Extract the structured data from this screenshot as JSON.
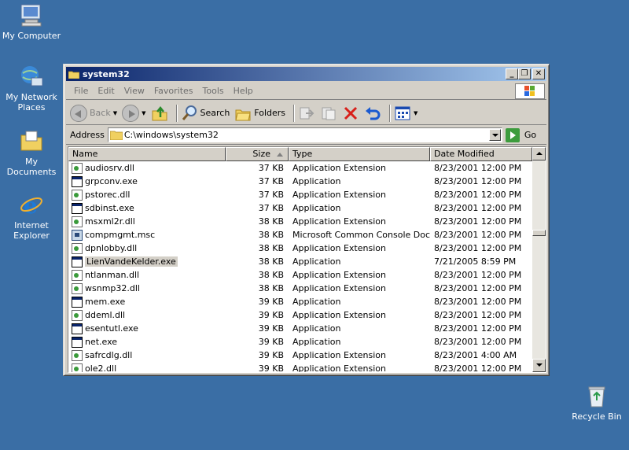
{
  "desktop": {
    "icons": [
      {
        "label": "My Computer"
      },
      {
        "label": "My Network Places"
      },
      {
        "label": "My Documents"
      },
      {
        "label": "Internet Explorer"
      },
      {
        "label": "Recycle Bin"
      }
    ]
  },
  "window": {
    "title": "system32",
    "controls": {
      "minimize": "_",
      "restore": "❐",
      "close": "✕"
    }
  },
  "menu": [
    "File",
    "Edit",
    "View",
    "Favorites",
    "Tools",
    "Help"
  ],
  "toolbar": {
    "back": "Back",
    "search": "Search",
    "folders": "Folders"
  },
  "address": {
    "label": "Address",
    "value": "C:\\windows\\system32",
    "go": "Go"
  },
  "columns": {
    "name": "Name",
    "size": "Size",
    "type": "Type",
    "date": "Date Modified"
  },
  "files": [
    {
      "name": "audiosrv.dll",
      "size": "37 KB",
      "type": "Application Extension",
      "date": "8/23/2001 12:00 PM",
      "kind": "dll"
    },
    {
      "name": "grpconv.exe",
      "size": "37 KB",
      "type": "Application",
      "date": "8/23/2001 12:00 PM",
      "kind": "exe"
    },
    {
      "name": "pstorec.dll",
      "size": "37 KB",
      "type": "Application Extension",
      "date": "8/23/2001 12:00 PM",
      "kind": "dll"
    },
    {
      "name": "sdbinst.exe",
      "size": "37 KB",
      "type": "Application",
      "date": "8/23/2001 12:00 PM",
      "kind": "exe"
    },
    {
      "name": "msxml2r.dll",
      "size": "38 KB",
      "type": "Application Extension",
      "date": "8/23/2001 12:00 PM",
      "kind": "dll"
    },
    {
      "name": "compmgmt.msc",
      "size": "38 KB",
      "type": "Microsoft Common Console Docu...",
      "date": "8/23/2001 12:00 PM",
      "kind": "msc"
    },
    {
      "name": "dpnlobby.dll",
      "size": "38 KB",
      "type": "Application Extension",
      "date": "8/23/2001 12:00 PM",
      "kind": "dll"
    },
    {
      "name": "LienVandeKelder.exe",
      "size": "38 KB",
      "type": "Application",
      "date": "7/21/2005 8:59 PM",
      "kind": "exe",
      "selected": true
    },
    {
      "name": "ntlanman.dll",
      "size": "38 KB",
      "type": "Application Extension",
      "date": "8/23/2001 12:00 PM",
      "kind": "dll"
    },
    {
      "name": "wsnmp32.dll",
      "size": "38 KB",
      "type": "Application Extension",
      "date": "8/23/2001 12:00 PM",
      "kind": "dll"
    },
    {
      "name": "mem.exe",
      "size": "39 KB",
      "type": "Application",
      "date": "8/23/2001 12:00 PM",
      "kind": "exe"
    },
    {
      "name": "ddeml.dll",
      "size": "39 KB",
      "type": "Application Extension",
      "date": "8/23/2001 12:00 PM",
      "kind": "dll"
    },
    {
      "name": "esentutl.exe",
      "size": "39 KB",
      "type": "Application",
      "date": "8/23/2001 12:00 PM",
      "kind": "exe"
    },
    {
      "name": "net.exe",
      "size": "39 KB",
      "type": "Application",
      "date": "8/23/2001 12:00 PM",
      "kind": "exe"
    },
    {
      "name": "safrcdlg.dll",
      "size": "39 KB",
      "type": "Application Extension",
      "date": "8/23/2001 4:00 AM",
      "kind": "dll"
    },
    {
      "name": "ole2.dll",
      "size": "39 KB",
      "type": "Application Extension",
      "date": "8/23/2001 12:00 PM",
      "kind": "dll"
    }
  ]
}
